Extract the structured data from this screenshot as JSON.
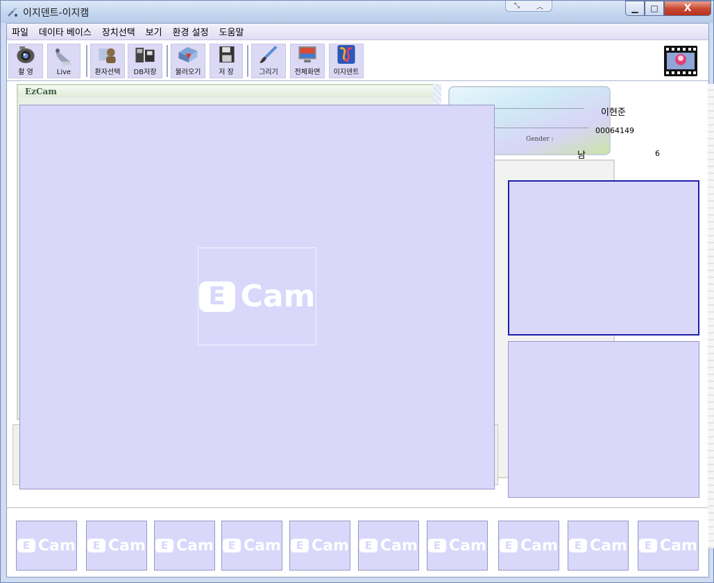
{
  "window": {
    "title": "이지덴트-이지캠",
    "controls": {
      "minimize": "▁",
      "maximize": "□",
      "close": "X"
    }
  },
  "menu": [
    "파일",
    "데이타 베이스",
    "장치선택",
    "보기",
    "환경 설정",
    "도움말"
  ],
  "toolbar": [
    {
      "label": "촬 영",
      "icon": "camera-icon"
    },
    {
      "label": "Live",
      "icon": "live-camera-icon"
    },
    {
      "label": "환자선택",
      "icon": "patient-select-icon"
    },
    {
      "label": "DB저장",
      "icon": "db-save-icon"
    },
    {
      "label": "불러오기",
      "icon": "load-icon"
    },
    {
      "label": "저 장",
      "icon": "floppy-save-icon"
    },
    {
      "label": "그리기",
      "icon": "brush-icon"
    },
    {
      "label": "전체화면",
      "icon": "fullscreen-monitor-icon"
    },
    {
      "label": "이지덴트",
      "icon": "ezdent-logo-icon"
    }
  ],
  "panel": {
    "header": "EzCam"
  },
  "patient": {
    "name": "이현준",
    "chart_no": "00064149",
    "gender_label": "Gender :",
    "gender": "남",
    "age": "6"
  },
  "logo": {
    "mark": "E",
    "text": "Cam"
  },
  "thumbnails": [
    "Cam",
    "Cam",
    "Cam",
    "Cam",
    "Cam",
    "Cam",
    "Cam",
    "Cam",
    "Cam",
    "Cam"
  ],
  "colors": {
    "viewer_bg": "#d9d8fb",
    "selected_border": "#1e1ea8",
    "close_red": "#c8462f"
  }
}
